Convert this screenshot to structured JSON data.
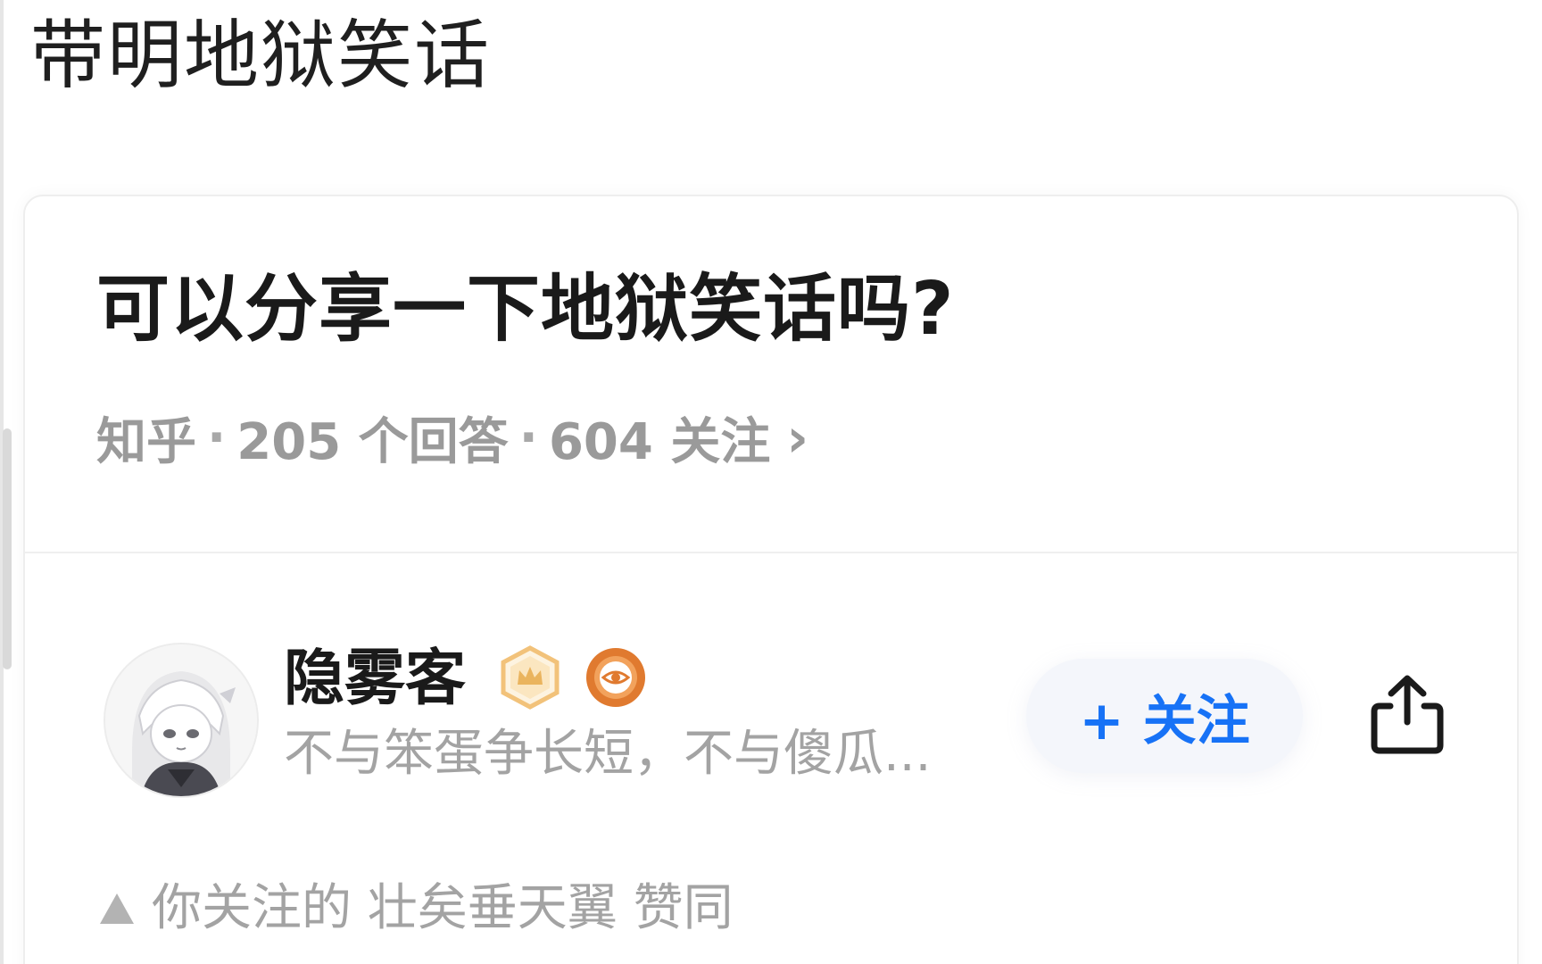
{
  "header": {
    "title": "带明地狱笑话"
  },
  "question": {
    "title": "可以分享一下地狱笑话吗?",
    "source": "知乎",
    "answers": "205 个回答",
    "followers": "604 关注",
    "separator": "·",
    "chevron": "›"
  },
  "answer": {
    "author_name": "隐雾客",
    "author_bio": "不与笨蛋争长短，不与傻瓜...",
    "follow_label": "+ 关注",
    "endorse_text": "你关注的 壮矣垂天翼 赞同",
    "badges": [
      "crown-badge-icon",
      "eye-badge-icon"
    ],
    "share_icon": "share-icon"
  },
  "colors": {
    "accent": "#1772f6",
    "text_primary": "#1a1a1a",
    "text_secondary": "#9a9a9a",
    "badge_gold": "#f0b860",
    "badge_orange": "#e07a2f"
  }
}
